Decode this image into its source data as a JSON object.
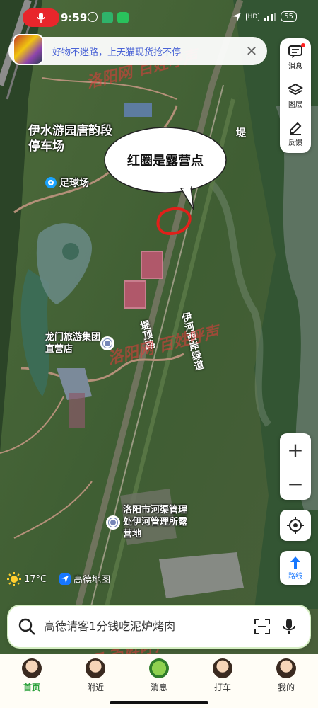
{
  "status": {
    "time": "9:59",
    "battery": "55"
  },
  "notification": {
    "text": "好物不迷路，上天猫现货抢不停",
    "close": "✕"
  },
  "side_panel": [
    {
      "key": "message",
      "label": "消息"
    },
    {
      "key": "layers",
      "label": "图层"
    },
    {
      "key": "feedback",
      "label": "反馈"
    }
  ],
  "map": {
    "bubble_text": "红圈是露营点",
    "labels": {
      "parking_lot": "伊水游园唐韵段停车场",
      "soccer": "足球场",
      "store": "龙门旅游集团直营店",
      "camp": "洛阳市河渠管理处伊河管理所露营地"
    },
    "roads": {
      "road_top": "堤",
      "road_mid": "堤顶路",
      "greenway": "伊河西岸绿道"
    },
    "watermarks": [
      "洛阳网 百姓呼声"
    ]
  },
  "zoom": {
    "in": "+",
    "out": "−"
  },
  "route_label": "路线",
  "weather": {
    "temp": "17°C"
  },
  "brand_name": "高德地图",
  "search": {
    "placeholder": "高德请客1分钱吃泥炉烤肉"
  },
  "tabs": [
    {
      "label": "首页",
      "active": true
    },
    {
      "label": "附近",
      "active": false
    },
    {
      "label": "消息",
      "active": false
    },
    {
      "label": "打车",
      "active": false
    },
    {
      "label": "我的",
      "active": false
    }
  ],
  "colors": {
    "accent": "#1677ff",
    "mic_red": "#e8262b",
    "active_tab": "#2aa13a",
    "camp_circle": "#e0201a"
  }
}
